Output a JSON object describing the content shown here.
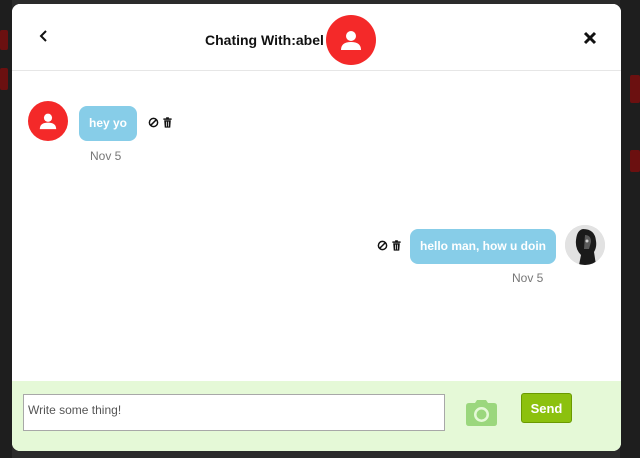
{
  "header": {
    "title": "Chating With:abel",
    "back_icon": "chevron-left-icon",
    "close_icon": "close-icon"
  },
  "messages": [
    {
      "side": "left",
      "text": "hey yo",
      "date": "Nov 5",
      "sender_avatar": "user-icon"
    },
    {
      "side": "right",
      "text": "hello man, how u doin",
      "date": "Nov 5",
      "sender_avatar": "profile-photo"
    }
  ],
  "message_actions": {
    "block_icon": "block-icon",
    "delete_icon": "trash-icon"
  },
  "composer": {
    "placeholder": "Write some thing!",
    "value": "",
    "camera_icon": "camera-icon",
    "send_label": "Send"
  },
  "colors": {
    "accent_red": "#f42929",
    "bubble": "#87cde8",
    "send_button": "#8cc10e",
    "footer_bg": "#e5f9d7",
    "camera": "#9bd77d"
  }
}
